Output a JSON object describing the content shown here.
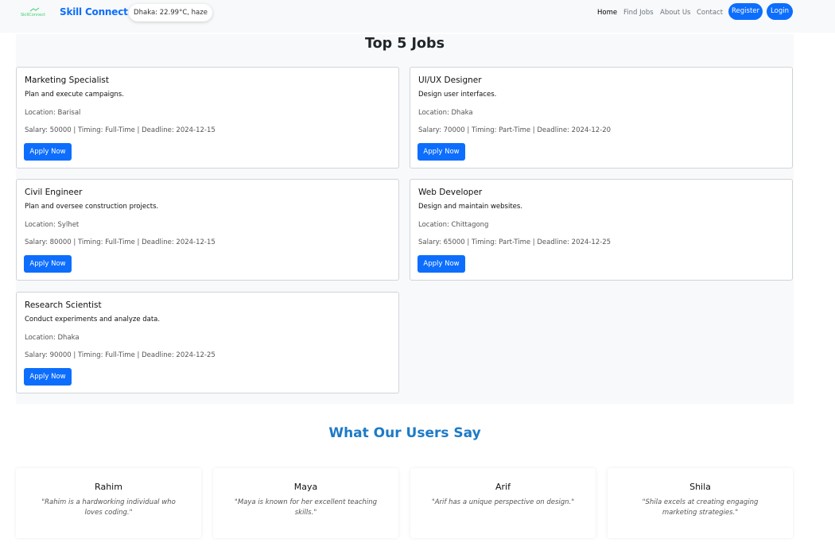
{
  "navbar": {
    "brand": "Skill Connect",
    "weather": "Dhaka: 22.99°C, haze",
    "links": [
      "Home",
      "Find Jobs",
      "About Us",
      "Contact"
    ],
    "register_label": "Register",
    "login_label": "Login"
  },
  "jobs": {
    "title": "Top 5 Jobs",
    "items": [
      {
        "title": "Marketing Specialist",
        "description": "Plan and execute campaigns.",
        "location": "Location: Barisal",
        "meta": "Salary: 50000 | Timing: Full-Time | Deadline: 2024-12-15",
        "button": "Apply Now"
      },
      {
        "title": "UI/UX Designer",
        "description": "Design user interfaces.",
        "location": "Location: Dhaka",
        "meta": "Salary: 70000 | Timing: Part-Time | Deadline: 2024-12-20",
        "button": "Apply Now"
      },
      {
        "title": "Civil Engineer",
        "description": "Plan and oversee construction projects.",
        "location": "Location: Sylhet",
        "meta": "Salary: 80000 | Timing: Full-Time | Deadline: 2024-12-15",
        "button": "Apply Now"
      },
      {
        "title": "Web Developer",
        "description": "Design and maintain websites.",
        "location": "Location: Chittagong",
        "meta": "Salary: 65000 | Timing: Part-Time | Deadline: 2024-12-25",
        "button": "Apply Now"
      },
      {
        "title": "Research Scientist",
        "description": "Conduct experiments and analyze data.",
        "location": "Location: Dhaka",
        "meta": "Salary: 90000 | Timing: Full-Time | Deadline: 2024-12-25",
        "button": "Apply Now"
      }
    ]
  },
  "testimonials": {
    "title": "What Our Users Say",
    "items": [
      {
        "name": "Rahim",
        "quote": "\"Rahim is a hardworking individual who loves coding.\""
      },
      {
        "name": "Maya",
        "quote": "\"Maya is known for her excellent teaching skills.\""
      },
      {
        "name": "Arif",
        "quote": "\"Arif has a unique perspective on design.\""
      },
      {
        "name": "Shila",
        "quote": "\"Shila excels at creating engaging marketing strategies.\""
      }
    ]
  },
  "colors": {
    "primary": "#0d6efd",
    "testimonial_heading": "#1d7ac7",
    "navbar_bg": "#f8f9fa",
    "section_bg": "#f8f9fa",
    "logo_green": "#3ccf6e"
  }
}
